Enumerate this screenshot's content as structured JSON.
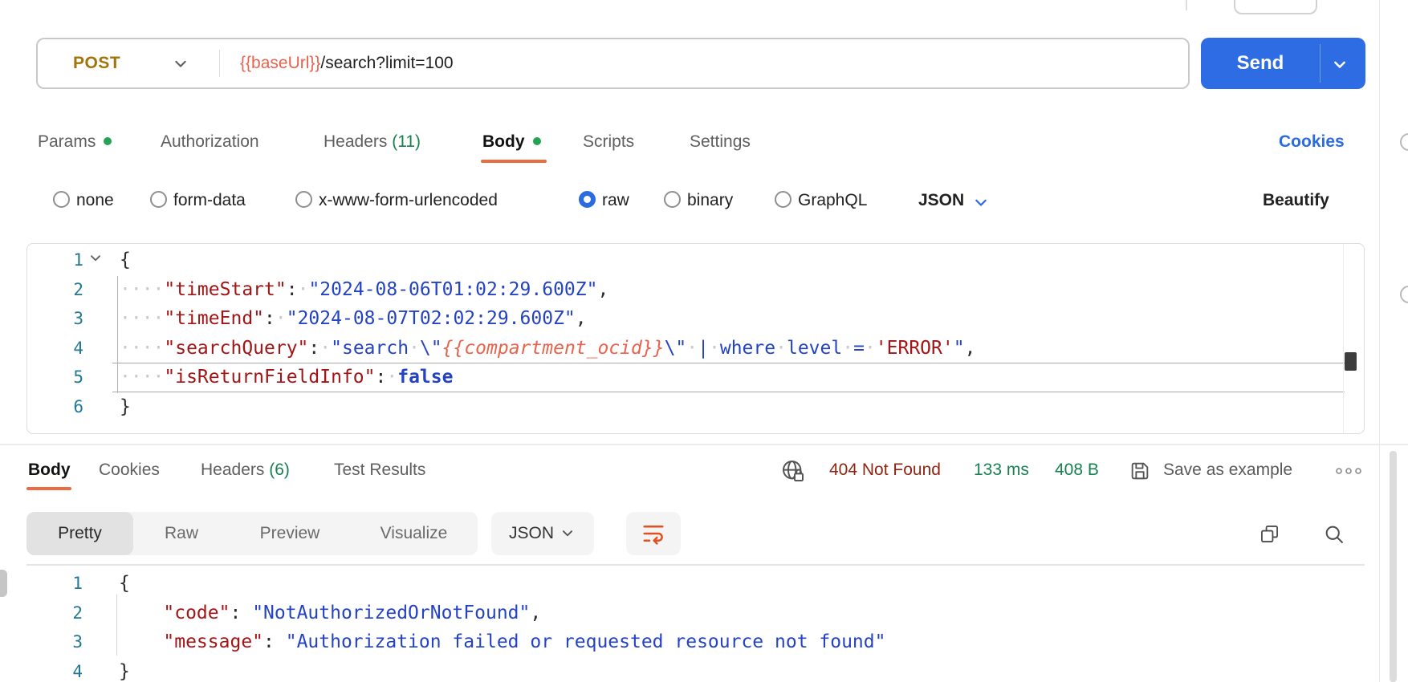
{
  "colors": {
    "accent_orange": "#ed6b40",
    "link_blue": "#2b6be0",
    "send_blue": "#2e6ce3",
    "method_post": "#a3740a",
    "variable_orange": "#e8624c",
    "dot_green": "#23a455",
    "count_green": "#178051",
    "status_red": "#8e2512",
    "token_key_red": "#a31515",
    "token_value_blue": "#2443c4",
    "line_number_blue": "#237893"
  },
  "request": {
    "method": "POST",
    "url_variable": "{{baseUrl}}",
    "url_path": "/search?limit=100",
    "send_label": "Send",
    "cookies_link": "Cookies",
    "tabs": {
      "params": "Params",
      "authorization": "Authorization",
      "headers": "Headers",
      "headers_count": "(11)",
      "body": "Body",
      "scripts": "Scripts",
      "settings": "Settings"
    },
    "body_types": [
      "none",
      "form-data",
      "x-www-form-urlencoded",
      "raw",
      "binary",
      "GraphQL"
    ],
    "selected_body_type": "raw",
    "language_selector": "JSON",
    "beautify_link": "Beautify",
    "editor": {
      "lines": [
        {
          "n": "1",
          "segs": [
            {
              "t": "{",
              "c": "pun"
            }
          ]
        },
        {
          "n": "2",
          "segs": [
            {
              "t": "····",
              "c": "ws"
            },
            {
              "t": "\"timeStart\"",
              "c": "key"
            },
            {
              "t": ":",
              "c": "pun"
            },
            {
              "t": "·",
              "c": "ws"
            },
            {
              "t": "\"2024-08-06T01:02:29.600Z\"",
              "c": "str"
            },
            {
              "t": ",",
              "c": "pun"
            }
          ]
        },
        {
          "n": "3",
          "segs": [
            {
              "t": "····",
              "c": "ws"
            },
            {
              "t": "\"timeEnd\"",
              "c": "key"
            },
            {
              "t": ":",
              "c": "pun"
            },
            {
              "t": "·",
              "c": "ws"
            },
            {
              "t": "\"2024-08-07T02:02:29.600Z\"",
              "c": "str"
            },
            {
              "t": ",",
              "c": "pun"
            }
          ]
        },
        {
          "n": "4",
          "segs": [
            {
              "t": "····",
              "c": "ws"
            },
            {
              "t": "\"searchQuery\"",
              "c": "key"
            },
            {
              "t": ":",
              "c": "pun"
            },
            {
              "t": "·",
              "c": "ws"
            },
            {
              "t": "\"search",
              "c": "str"
            },
            {
              "t": "·",
              "c": "ws"
            },
            {
              "t": "\\\"",
              "c": "str"
            },
            {
              "t": "{{compartment_ocid}}",
              "c": "var"
            },
            {
              "t": "\\\"",
              "c": "str"
            },
            {
              "t": "·",
              "c": "ws"
            },
            {
              "t": "|",
              "c": "str"
            },
            {
              "t": "·",
              "c": "ws"
            },
            {
              "t": "where",
              "c": "str"
            },
            {
              "t": "·",
              "c": "ws"
            },
            {
              "t": "level",
              "c": "str"
            },
            {
              "t": "·",
              "c": "ws"
            },
            {
              "t": "=",
              "c": "str"
            },
            {
              "t": "·",
              "c": "ws"
            },
            {
              "t": "'ERROR'",
              "c": "key"
            },
            {
              "t": "\"",
              "c": "str"
            },
            {
              "t": ",",
              "c": "pun"
            }
          ]
        },
        {
          "n": "5",
          "segs": [
            {
              "t": "····",
              "c": "ws"
            },
            {
              "t": "\"isReturnFieldInfo\"",
              "c": "key"
            },
            {
              "t": ":",
              "c": "pun"
            },
            {
              "t": "·",
              "c": "ws"
            },
            {
              "t": "false",
              "c": "bool"
            }
          ]
        },
        {
          "n": "6",
          "segs": [
            {
              "t": "}",
              "c": "pun"
            }
          ]
        }
      ]
    }
  },
  "response": {
    "tabs": {
      "body": "Body",
      "cookies": "Cookies",
      "headers": "Headers",
      "headers_count": "(6)",
      "test_results": "Test Results"
    },
    "status": "404 Not Found",
    "time": "133 ms",
    "size": "408 B",
    "save_as_example": "Save as example",
    "views": [
      "Pretty",
      "Raw",
      "Preview",
      "Visualize"
    ],
    "selected_view": "Pretty",
    "language_selector": "JSON",
    "editor": {
      "lines": [
        {
          "n": "1",
          "segs": [
            {
              "t": "{",
              "c": "pun"
            }
          ]
        },
        {
          "n": "2",
          "segs": [
            {
              "t": "    ",
              "c": "sp"
            },
            {
              "t": "\"code\"",
              "c": "key"
            },
            {
              "t": ": ",
              "c": "pun"
            },
            {
              "t": "\"NotAuthorizedOrNotFound\"",
              "c": "str"
            },
            {
              "t": ",",
              "c": "pun"
            }
          ]
        },
        {
          "n": "3",
          "segs": [
            {
              "t": "    ",
              "c": "sp"
            },
            {
              "t": "\"message\"",
              "c": "key"
            },
            {
              "t": ": ",
              "c": "pun"
            },
            {
              "t": "\"Authorization failed or requested resource not found\"",
              "c": "str"
            }
          ]
        },
        {
          "n": "4",
          "segs": [
            {
              "t": "}",
              "c": "pun"
            }
          ]
        }
      ]
    }
  }
}
